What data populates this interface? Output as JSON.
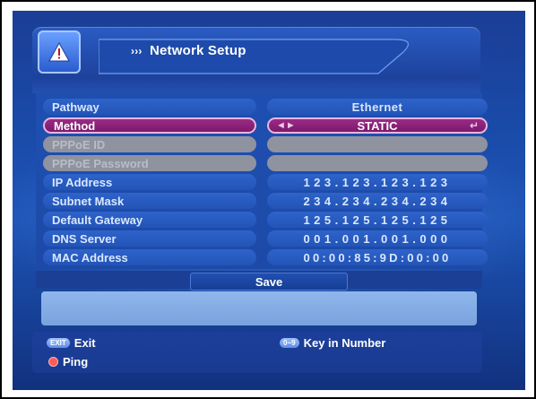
{
  "header": {
    "title": "Network Setup",
    "title_arrows": "›››"
  },
  "rows": [
    {
      "label": "Pathway",
      "value": "Ethernet"
    },
    {
      "label": "Method",
      "value": "STATIC"
    },
    {
      "label": "PPPoE ID",
      "value": ""
    },
    {
      "label": "PPPoE Password",
      "value": ""
    },
    {
      "label": "IP Address",
      "value": "123.123.123.123"
    },
    {
      "label": "Subnet Mask",
      "value": "234.234.234.234"
    },
    {
      "label": "Default Gateway",
      "value": "125.125.125.125"
    },
    {
      "label": "DNS Server",
      "value": "001.001.001.000"
    },
    {
      "label": "MAC Address",
      "value": "00:00:85:9D:00:00"
    }
  ],
  "save_label": "Save",
  "footer": {
    "exit_key": "EXIT",
    "exit_label": "Exit",
    "number_key": "0~9",
    "number_label": "Key in Number",
    "ping_label": "Ping"
  },
  "colors": {
    "screen_bg": "#1c54b6",
    "selected_row": "#9c2a86",
    "disabled_row": "#8f93a0",
    "info_box": "#8fb7ec",
    "ping_dot": "#ff5a5a"
  },
  "icons": {
    "logo": "warning-triangle-icon",
    "select_left": "left-right-arrows-icon",
    "select_right": "enter-return-icon",
    "ping": "red-dot-icon"
  }
}
